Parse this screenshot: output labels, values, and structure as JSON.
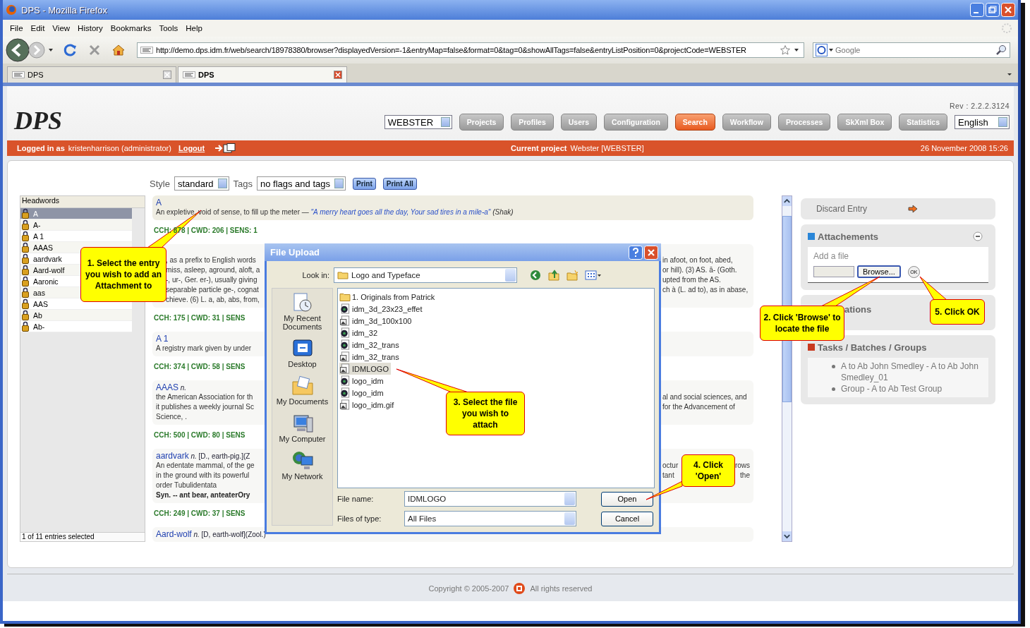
{
  "window": {
    "title": "DPS - Mozilla Firefox"
  },
  "menu": [
    "File",
    "Edit",
    "View",
    "History",
    "Bookmarks",
    "Tools",
    "Help"
  ],
  "address": {
    "url": "http://demo.dps.idm.fr/web/search/18978380/browser?displayedVersion=-1&entryMap=false&format=0&tag=0&showAllTags=false&entryListPosition=0&projectCode=WEBSTER"
  },
  "search": {
    "placeholder": "Google"
  },
  "tabs": [
    {
      "label": "DPS",
      "selected": false
    },
    {
      "label": "DPS",
      "selected": true
    }
  ],
  "app": {
    "logo": "DPS",
    "revision": "Rev : 2.2.2.3124",
    "project_select": "WEBSTER",
    "language": "English",
    "nav": [
      {
        "label": "Projects",
        "selected": false
      },
      {
        "label": "Profiles",
        "selected": false
      },
      {
        "label": "Users",
        "selected": false
      },
      {
        "label": "Configuration",
        "selected": false
      },
      {
        "label": "Search",
        "selected": true
      },
      {
        "label": "Workflow",
        "selected": false
      },
      {
        "label": "Processes",
        "selected": false
      },
      {
        "label": "SkXml Box",
        "selected": false
      },
      {
        "label": "Statistics",
        "selected": false
      }
    ]
  },
  "user_bar": {
    "logged_label": "Logged in as",
    "user": "kristenharrison (administrator)",
    "logout": "Logout",
    "project_label": "Current project",
    "project": "Webster [WEBSTER]",
    "datetime": "26 November 2008 15:26"
  },
  "toolbar": {
    "style_label": "Style",
    "style": "standard",
    "tags_label": "Tags",
    "tags": "no flags and tags",
    "buttons": [
      "Print",
      "Print All"
    ]
  },
  "headwords": {
    "title": "Headwords",
    "status": "1 of 11 entries selected",
    "items": [
      {
        "label": "A",
        "selected": true
      },
      {
        "label": "A-",
        "selected": false
      },
      {
        "label": "A 1",
        "selected": false
      },
      {
        "label": "AAAS",
        "selected": false
      },
      {
        "label": "aardvark",
        "selected": false
      },
      {
        "label": "Aard-wolf",
        "selected": false
      },
      {
        "label": "Aaronic",
        "selected": false
      },
      {
        "label": "aas",
        "selected": false
      },
      {
        "label": "AAS",
        "selected": false
      },
      {
        "label": "Ab",
        "selected": false
      },
      {
        "label": "Ab-",
        "selected": false
      }
    ]
  },
  "entries": [
    {
      "kind": "entry",
      "headword": "A",
      "definition": {
        "text": "An expletive, void of sense, to fill up the meter —",
        "quote": "\"A merry heart goes all the day, Your sad tires in a mile-a\"",
        "source": "(Shak)"
      }
    },
    {
      "kind": "stats",
      "text": "CCH: 878 | CWD: 206 | SENS: 1"
    },
    {
      "kind": "entry",
      "lines": [
        {
          "left": ", as a prefix to English words",
          "right": [
            "in afoot, on foot, abed,"
          ]
        },
        {
          "left": "miss, asleep, aground, aloft, a",
          "right": [
            "or hill). (3) AS. ā- (Goth."
          ]
        },
        {
          "left": "-, ur-, Ger. er-), usually giving",
          "right": [
            "upted from the AS."
          ]
        },
        {
          "left": "separable particle ge-, cognat",
          "right": [
            "ch à (L. ad to), as in abase,"
          ]
        },
        {
          "left": "chieve. (6) L. a, ab, abs, from,"
        }
      ]
    },
    {
      "kind": "stats",
      "text": "CCH: 175 | CWD: 31 | SENS"
    },
    {
      "kind": "entry",
      "headword": "A 1",
      "lines": [
        {
          "left": "A registry mark given by under"
        }
      ]
    },
    {
      "kind": "stats",
      "text": "CCH: 374 | CWD: 58 | SENS"
    },
    {
      "kind": "entry",
      "headword": "AAAS",
      "rest": "*n.*",
      "lines": [
        {
          "left": "the American Association for th",
          "right": [
            "al and social sciences, and"
          ]
        },
        {
          "left": "it publishes a weekly journal Sc",
          "right": [
            "for the Advancement of"
          ]
        },
        {
          "left": "Science, ."
        }
      ]
    },
    {
      "kind": "stats",
      "text": "CCH: 500 | CWD: 80 | SENS"
    },
    {
      "kind": "entry",
      "headword": "aardvark",
      "rest": "*n.* [D., earth-pig.](Z",
      "lines": [
        {
          "left": "An edentate mammal, of the ge",
          "right": [
            "octur",
            "rows"
          ]
        },
        {
          "left": "in the ground with its powerful",
          "right": [
            "tant",
            "the"
          ]
        },
        {
          "left": "order Tubulidentata"
        }
      ],
      "synonym": "Syn. -- ant bear, anteaterOry"
    },
    {
      "kind": "stats",
      "text": "CCH: 249 | CWD: 37 | SENS"
    },
    {
      "kind": "entry",
      "headword": "Aard-wolf",
      "rest": "*n.* [D, earth-wolf](Zool.)"
    }
  ],
  "side": {
    "discard": "Discard Entry",
    "attachments": {
      "title": "Attachements",
      "add_label": "Add a file",
      "browse": "Browse...",
      "ok": "OK"
    },
    "annotations": {
      "title": "ations"
    },
    "tasks": {
      "title": "Tasks / Batches / Groups",
      "items": [
        "A to Ab John Smedley - A to Ab John Smedley_01",
        "Group - A to Ab Test Group"
      ]
    }
  },
  "dialog": {
    "title": "File Upload",
    "look_in_label": "Look in:",
    "look_in": "Logo and Typeface",
    "places": [
      {
        "label": "My Recent Documents",
        "kind": "recent"
      },
      {
        "label": "Desktop",
        "kind": "desktop"
      },
      {
        "label": "My Documents",
        "kind": "documents"
      },
      {
        "label": "My Computer",
        "kind": "computer"
      },
      {
        "label": "My Network",
        "kind": "network"
      }
    ],
    "files": [
      {
        "name": "1. Originals from Patrick",
        "kind": "folder",
        "selected": false
      },
      {
        "name": "idm_3d_23x23_effet",
        "kind": "media",
        "selected": false
      },
      {
        "name": "idm_3d_100x100",
        "kind": "image",
        "selected": false
      },
      {
        "name": "idm_32",
        "kind": "media",
        "selected": false
      },
      {
        "name": "idm_32_trans",
        "kind": "media",
        "selected": false
      },
      {
        "name": "idm_32_trans",
        "kind": "image",
        "selected": false
      },
      {
        "name": "IDMLOGO",
        "kind": "image",
        "selected": true
      },
      {
        "name": "logo_idm",
        "kind": "media",
        "selected": false
      },
      {
        "name": "logo_idm",
        "kind": "media",
        "selected": false
      },
      {
        "name": "logo_idm.gif",
        "kind": "image",
        "selected": false
      }
    ],
    "file_name_label": "File name:",
    "file_name": "IDMLOGO",
    "type_label": "Files of type:",
    "type": "All Files",
    "buttons": [
      "Open",
      "Cancel"
    ]
  },
  "callouts": [
    "1. Select the entry you wish to add an Attachment to",
    "2. Click 'Browse' to locate the file",
    "3. Select the file you wish to attach",
    "4. Click 'Open'",
    "5. Click OK"
  ],
  "footer": {
    "copyright": "Copyright © 2005-2007",
    "rights": "All rights reserved"
  }
}
